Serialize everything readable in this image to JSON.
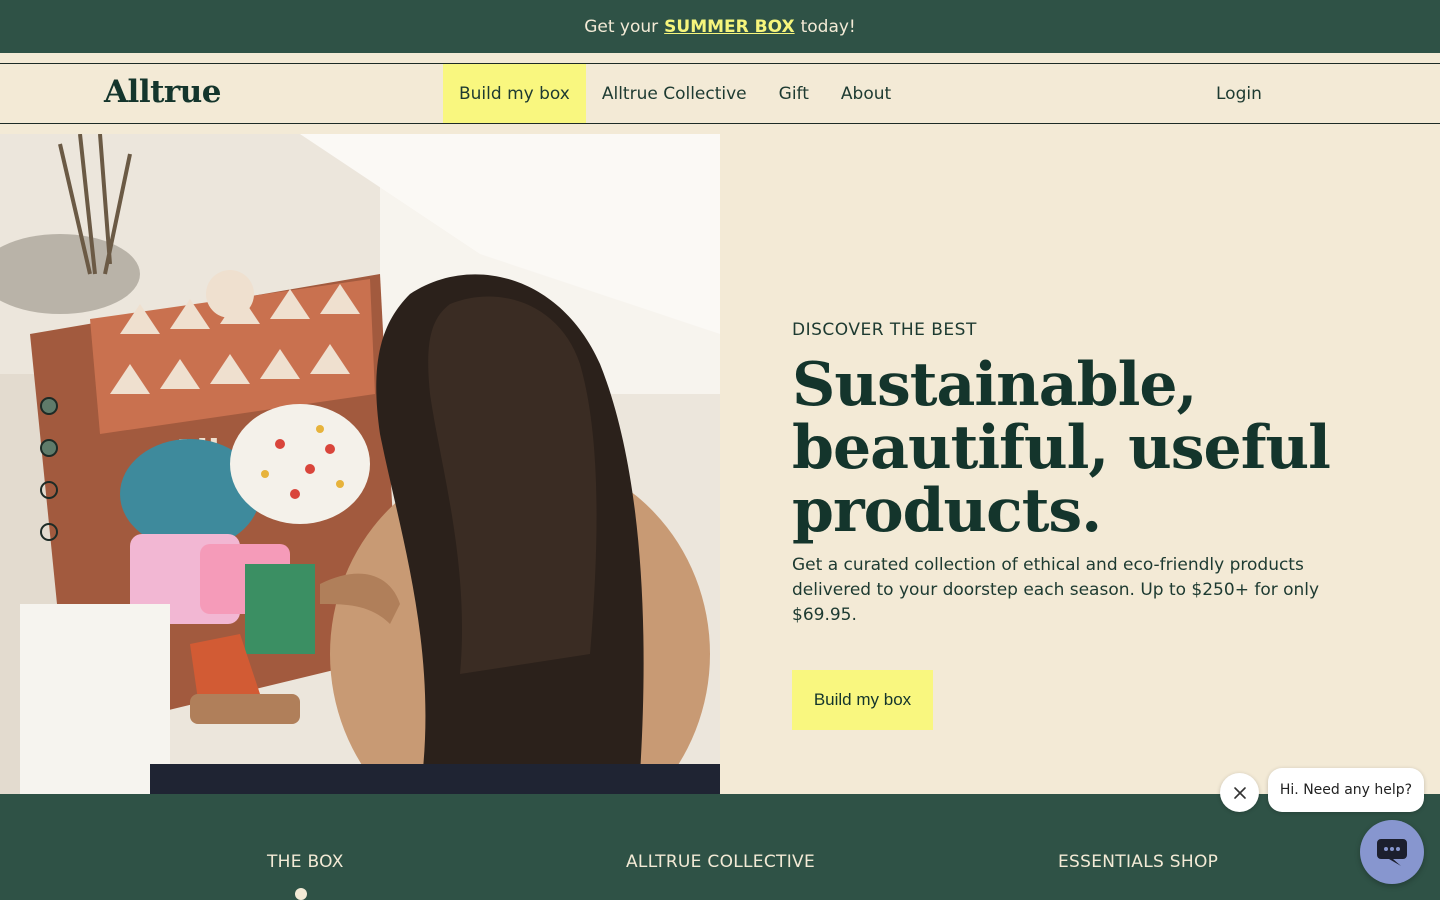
{
  "promo": {
    "prefix": "Get your",
    "link": "SUMMER BOX",
    "suffix": "today!"
  },
  "nav": {
    "logo": "Alltrue",
    "links": [
      "Build my box",
      "Alltrue Collective",
      "Gift",
      "About"
    ],
    "login": "Login"
  },
  "hero": {
    "eyebrow": "DISCOVER THE BEST",
    "headline": "Sustainable, beautiful, useful products.",
    "subtext": "Get a curated collection of ethical and eco-friendly products delivered to your doorstep each season. Up to $250+ for only $69.95.",
    "cta": "Build my box",
    "image_box_text": "All",
    "carousel": {
      "slide_count": 4,
      "filled_slides": [
        1,
        2
      ]
    }
  },
  "footer": {
    "categories": [
      "THE BOX",
      "ALLTRUE COLLECTIVE",
      "ESSENTIALS SHOP"
    ]
  },
  "chat": {
    "message": "Hi. Need any help?"
  },
  "colors": {
    "dark_green": "#2f5246",
    "cream": "#f3ead6",
    "yellow": "#f9f77f",
    "chat_blue": "#8796cf",
    "text": "#14352c"
  }
}
